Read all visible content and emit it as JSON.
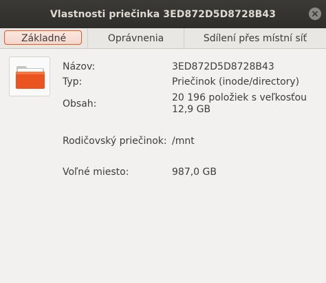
{
  "window": {
    "title": "Vlastnosti priečinka 3ED872D5D8728B43"
  },
  "tabs": [
    {
      "label": "Základné",
      "active": true
    },
    {
      "label": "Oprávnenia",
      "active": false
    },
    {
      "label": "Sdílení přes místní síť",
      "active": false
    }
  ],
  "icon": {
    "name": "folder-icon",
    "color": "#e95420"
  },
  "properties": {
    "name_label": "Názov:",
    "name_value": "3ED872D5D8728B43",
    "type_label": "Typ:",
    "type_value": "Priečinok (inode/directory)",
    "contents_label": "Obsah:",
    "contents_value_line1": "20 196 položiek s veľkosťou",
    "contents_value_line2": "12,9 GB",
    "parent_label": "Rodičovský priečinok:",
    "parent_value": "/mnt",
    "free_label": "Voľné miesto:",
    "free_value": "987,0 GB"
  },
  "colors": {
    "accent": "#e95420",
    "titlebar": "#2f2e2b",
    "background": "#f2f1f0"
  }
}
